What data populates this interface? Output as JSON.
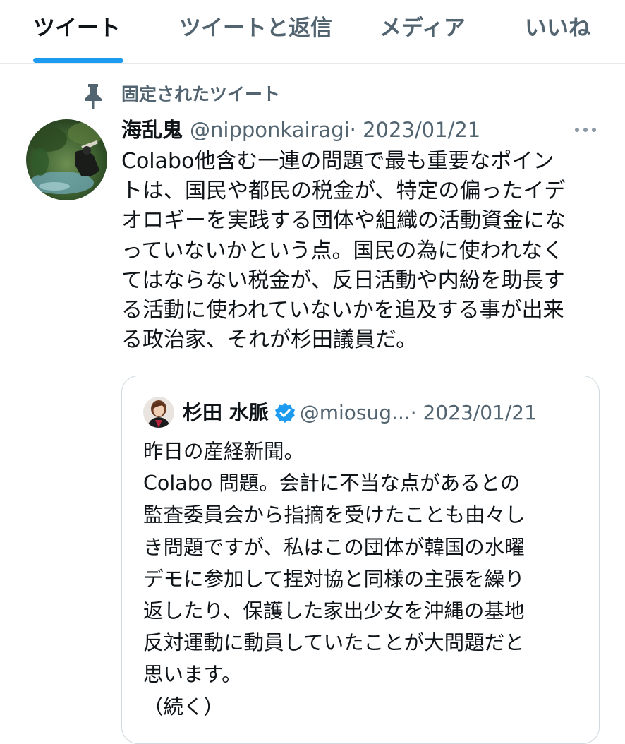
{
  "tabs": [
    {
      "label": "ツイート",
      "active": true
    },
    {
      "label": "ツイートと返信",
      "active": false
    },
    {
      "label": "メディア",
      "active": false
    },
    {
      "label": "いいね",
      "active": false
    }
  ],
  "accent_color": "#1d9bf0",
  "pinned": {
    "label": "固定されたツイート",
    "icon": "pin-icon"
  },
  "tweet": {
    "author_name": "海乱鬼",
    "handle": "@nipponkairagi",
    "date": "· 2023/01/21",
    "more_icon": "more-horizontal-icon",
    "text_lines": [
      "Colabo他含む一連の問題で最も重要なポイン",
      "トは、国民や都民の税金が、特定の偏ったイデ",
      "オロギーを実践する団体や組織の活動資金にな",
      "っていないかという点。国民の為に使われなく",
      "てはならない税金が、反日活動や内紛を助長す",
      "る活動に使われていないかを追及する事が出来",
      "る政治家、それが杉田議員だ。"
    ]
  },
  "quote": {
    "author_name": "杉田 水脈",
    "verified_icon": "verified-badge-icon",
    "handle": "@miosug...",
    "date": "· 2023/01/21",
    "text_lines": [
      "昨日の産経新聞。",
      "Colabo 問題。会計に不当な点があるとの",
      "監査委員会から指摘を受けたことも由々し",
      "き問題ですが、私はこの団体が韓国の水曜",
      "デモに参加して捏対協と同様の主張を繰り",
      "返したり、保護した家出少女を沖縄の基地",
      "反対運動に動員していたことが大問題だと",
      "思います。",
      "（続く）"
    ]
  }
}
